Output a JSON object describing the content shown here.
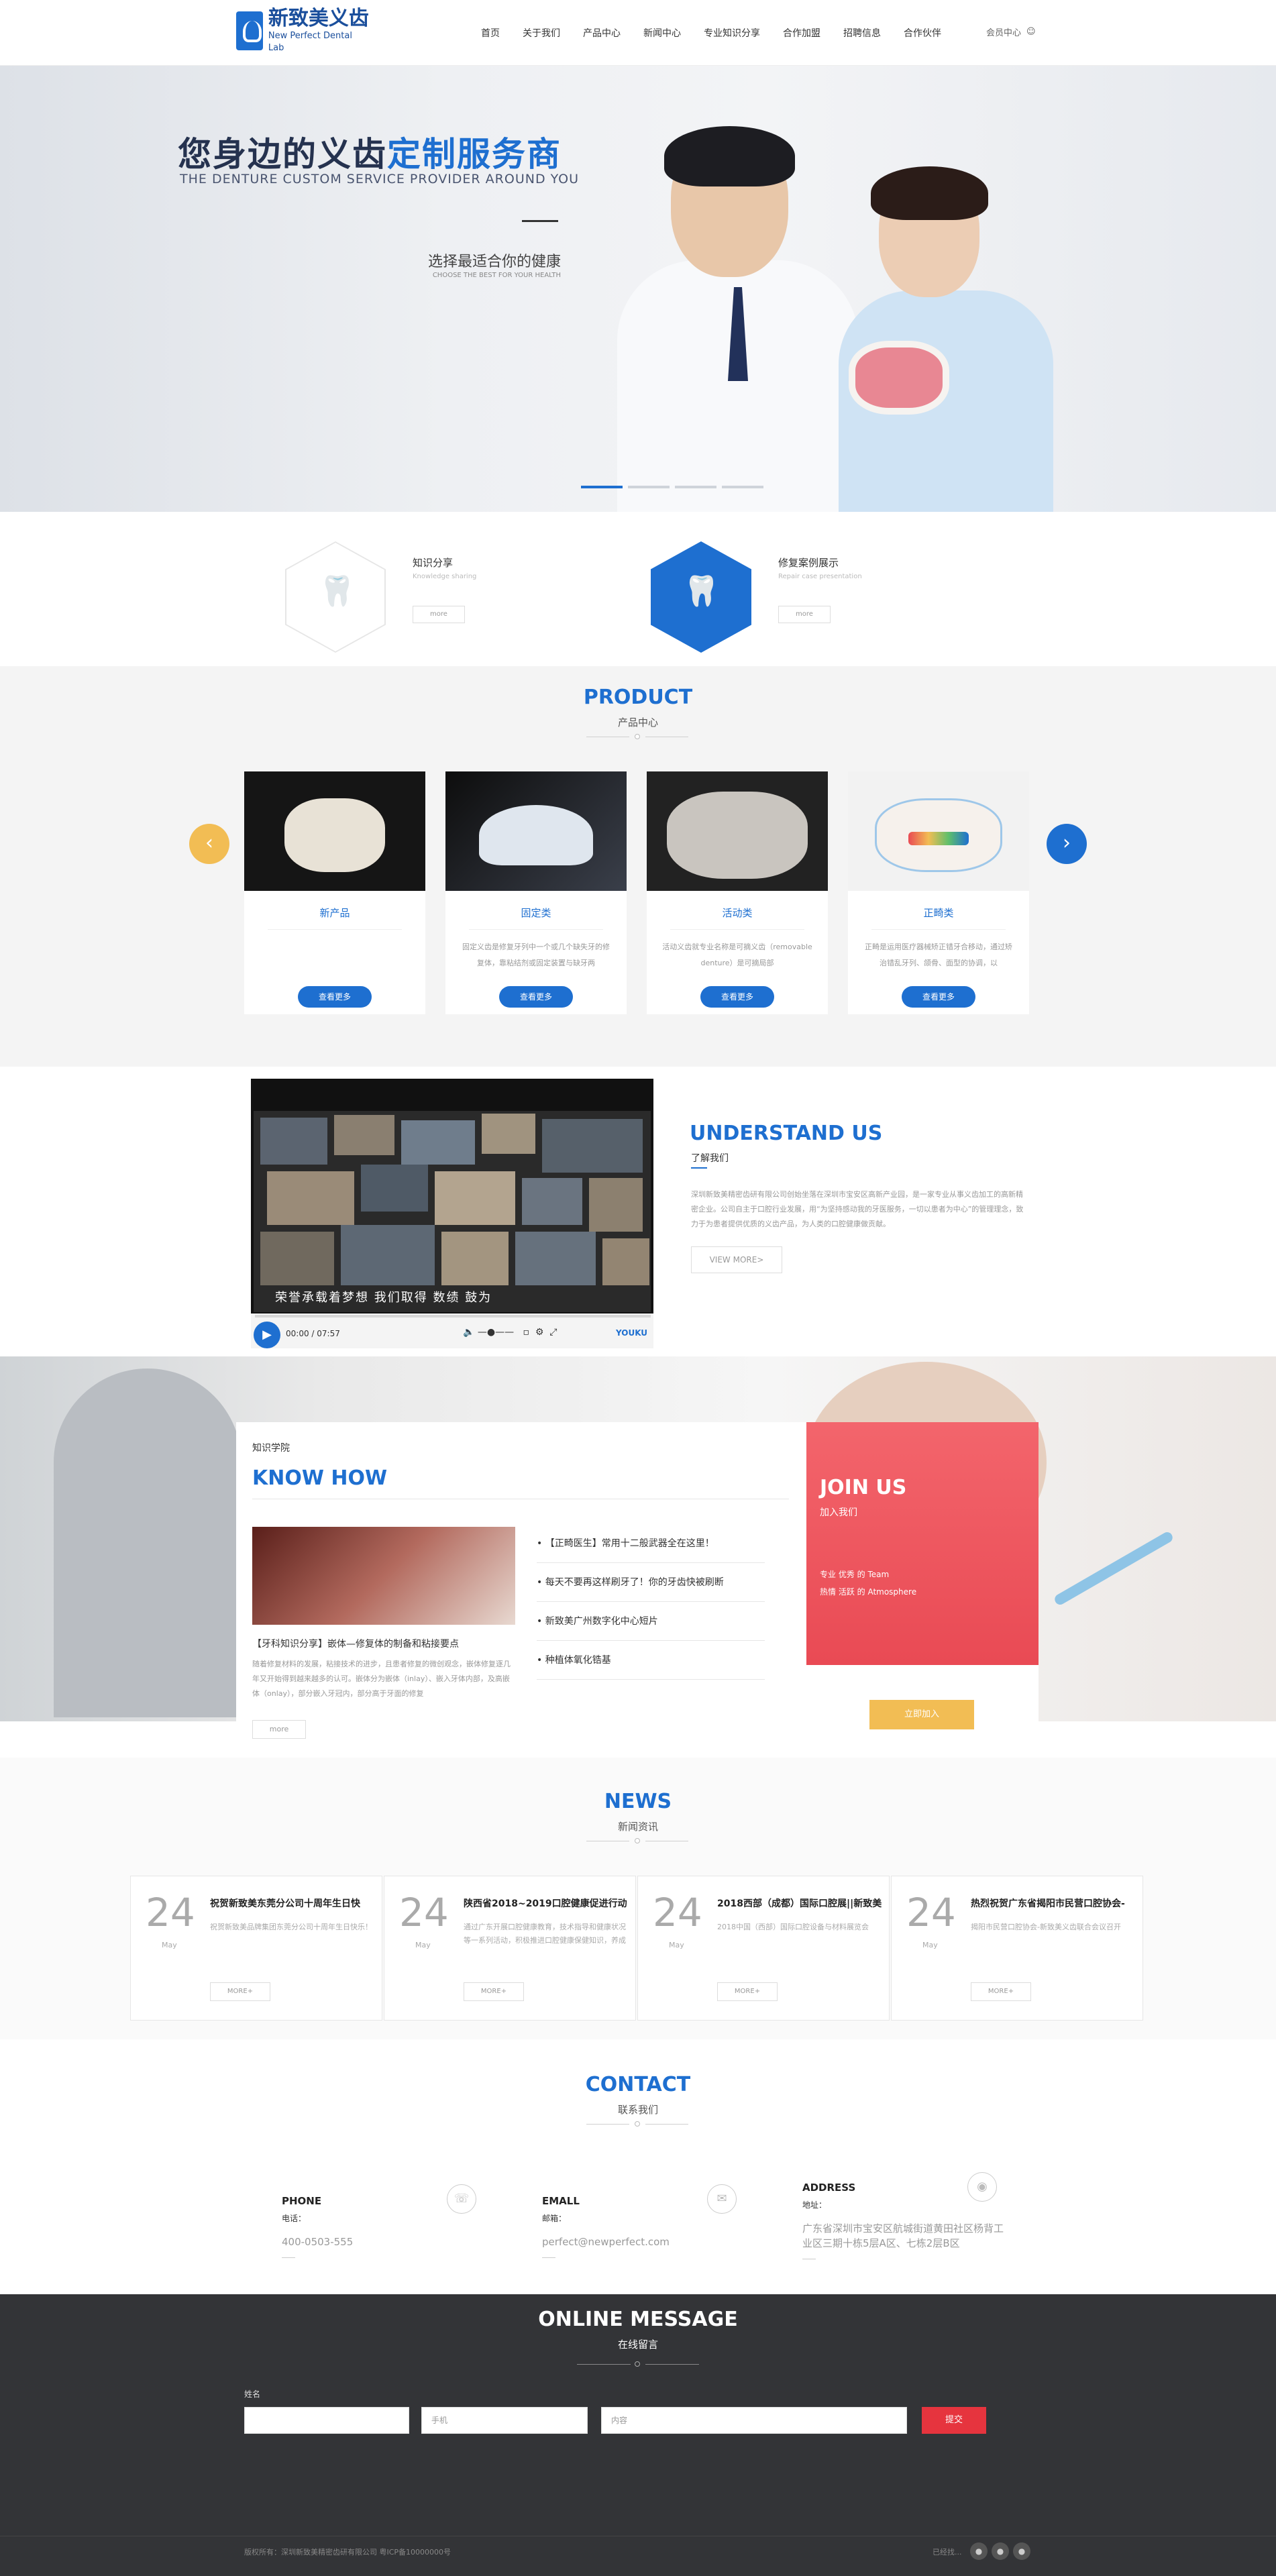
{
  "header": {
    "logo_cn": "新致美义齿",
    "logo_en": "New Perfect Dental Lab",
    "nav": [
      "首页",
      "关于我们",
      "产品中心",
      "新闻中心",
      "专业知识分享",
      "合作加盟",
      "招聘信息",
      "合作伙伴"
    ],
    "login": "会员中心"
  },
  "hero": {
    "title_a": "您身边的义齿",
    "title_b": "定制服务商",
    "subtitle": "THE DENTURE CUSTOM SERVICE PROVIDER AROUND YOU",
    "slogan": "选择最适合你的健康",
    "slogan_en": "CHOOSE THE BEST FOR YOUR HEALTH",
    "slides_total": 4,
    "slide_active": 1
  },
  "features": [
    {
      "title": "知识分享",
      "sub": "Knowledge sharing",
      "more": "more"
    },
    {
      "title": "修复案例展示",
      "sub": "Repair case presentation",
      "more": "more"
    }
  ],
  "product": {
    "title": "PRODUCT",
    "subtitle": "产品中心",
    "cards": [
      {
        "title": "新产品",
        "desc": "",
        "btn": "查看更多"
      },
      {
        "title": "固定类",
        "desc": "固定义齿是修复牙列中一个或几个缺失牙的修复体，靠粘结剂或固定装置与缺牙两",
        "btn": "查看更多"
      },
      {
        "title": "活动类",
        "desc": "活动义齿就专业名称是可摘义齿（removable denture）是可摘局部",
        "btn": "查看更多"
      },
      {
        "title": "正畸类",
        "desc": "正畸是运用医疗器械矫正错牙合移动，通过矫治错乱牙列、颌骨、面型的协调，以",
        "btn": "查看更多"
      }
    ]
  },
  "understand": {
    "title": "UNDERSTAND US",
    "subtitle": "了解我们",
    "desc": "深圳新致美精密齿研有限公司创始坐落在深圳市宝安区高新产业园，是一家专业从事义齿加工的高新精密企业。公司自主于口腔行业发展，用“为坚持感动我的牙医服务，一切以患者为中心”的管理理念，致力于为患者提供优质的义齿产品，为人类的口腔健康做贡献。",
    "more": "VIEW MORE>",
    "video": {
      "caption": "荣誉承载着梦想 我们取得 数绩 鼓为",
      "time": "00:00 / 07:57",
      "brand": "YOUKU"
    }
  },
  "knowhow": {
    "tag": "知识学院",
    "title": "KNOW HOW",
    "headline": "【牙科知识分享】嵌体—修复体的制备和粘接要点",
    "desc": "随着修复材料的发展，粘接技术的进步，且患者修复的微创观念，嵌体修复逐几年又开始得到越来越多的认可。嵌体分为嵌体（inlay）、嵌入牙体内部，及高嵌体（onlay），部分嵌入牙冠内，部分高于牙面的修复",
    "more": "more",
    "list": [
      "【正畸医生】常用十二般武器全在这里！",
      "每天不要再这样刷牙了！你的牙齿快被刷断",
      "新致美广州数字化中心短片",
      "种植体氧化锆基"
    ]
  },
  "join": {
    "title": "JOIN US",
    "subtitle": "加入我们",
    "line1": "专业 优秀 的 Team",
    "line2": "热情 活跃 的 Atmosphere",
    "btn": "立即加入"
  },
  "news": {
    "title": "NEWS",
    "subtitle": "新闻资讯",
    "items": [
      {
        "day": "24",
        "month": "May",
        "title": "祝贺新致美东莞分公司十周年生日快",
        "desc": "祝贺新致美品牌集团东莞分公司十周年生日快乐！",
        "more": "MORE+"
      },
      {
        "day": "24",
        "month": "May",
        "title": "陕西省2018~2019口腔健康促进行动",
        "desc": "通过广东开展口腔健康教育，技术指导和健康状况等一系列活动，积极推进口腔健康保健知识，养成良好的口腔健康保健习惯，提高口腔",
        "more": "MORE+"
      },
      {
        "day": "24",
        "month": "May",
        "title": "2018西部（成都）国际口腔展||新致美",
        "desc": "2018中国（西部）国际口腔设备与材料展览会",
        "more": "MORE+"
      },
      {
        "day": "24",
        "month": "May",
        "title": "热烈祝贺广东省揭阳市民营口腔协会-",
        "desc": "揭阳市民营口腔协会-新致美义齿联合会议召开",
        "more": "MORE+"
      }
    ]
  },
  "contact": {
    "title": "CONTACT",
    "subtitle": "联系我们",
    "phone": {
      "title": "PHONE",
      "label": "电话：",
      "value": "400-0503-555"
    },
    "email": {
      "title": "EMALL",
      "label": "邮箱：",
      "value": "perfect@newperfect.com"
    },
    "address": {
      "title": "ADDRESS",
      "label": "地址：",
      "value": "广东省深圳市宝安区航城街道黄田社区杨背工业区三期十栋5层A区、七栋2层B区"
    }
  },
  "online": {
    "title": "ONLINE MESSAGE",
    "subtitle": "在线留言",
    "label": "姓名",
    "name_ph": "",
    "phone_ph": "手机",
    "content_ph": "内容",
    "submit": "提交"
  },
  "footer": {
    "left": "版权所有：深圳新致美精密齿研有限公司 粤ICP备10000000号",
    "right": "已经找..."
  },
  "colors": {
    "brand": "#1e6fd0",
    "accent_red": "#e94a54",
    "accent_yellow": "#f2bd54"
  }
}
